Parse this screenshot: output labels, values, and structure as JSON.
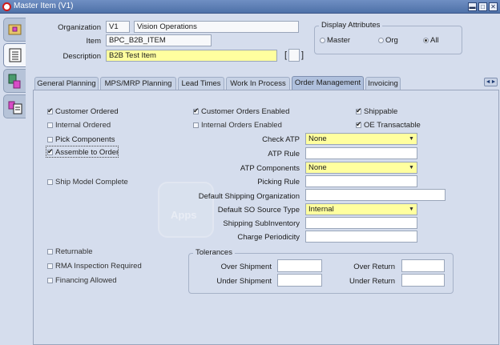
{
  "window": {
    "title": "Master Item (V1)",
    "min_label": "▬",
    "max_label": "□",
    "close_label": "✕"
  },
  "header": {
    "organization_label": "Organization",
    "organization_code": "V1",
    "organization_name": "Vision Operations",
    "item_label": "Item",
    "item_value": "BPC_B2B_ITEM",
    "description_label": "Description",
    "description_value": "B2B Test Item",
    "flex_open": "[",
    "flex_close": "]"
  },
  "display_attributes": {
    "legend": "Display Attributes",
    "options": [
      "Master",
      "Org",
      "All"
    ],
    "selected": "All"
  },
  "tabs": [
    "General Planning",
    "MPS/MRP Planning",
    "Lead Times",
    "Work In Process",
    "Order Management",
    "Invoicing"
  ],
  "active_tab": "Order Management",
  "order_management": {
    "customer_ordered": "Customer Ordered",
    "internal_ordered": "Internal Ordered",
    "pick_components": "Pick Components",
    "assemble_to_order": "Assemble to Order",
    "ship_model_complete": "Ship Model Complete",
    "customer_orders_enabled": "Customer Orders Enabled",
    "internal_orders_enabled": "Internal Orders Enabled",
    "shippable": "Shippable",
    "oe_transactable": "OE Transactable",
    "check_atp_label": "Check ATP",
    "check_atp_value": "None",
    "atp_rule_label": "ATP Rule",
    "atp_rule_value": "",
    "atp_components_label": "ATP Components",
    "atp_components_value": "None",
    "picking_rule_label": "Picking Rule",
    "picking_rule_value": "",
    "default_shipping_org_label": "Default Shipping Organization",
    "default_shipping_org_value": "",
    "default_so_source_type_label": "Default SO Source Type",
    "default_so_source_type_value": "Internal",
    "shipping_subinventory_label": "Shipping SubInventory",
    "shipping_subinventory_value": "",
    "charge_periodicity_label": "Charge Periodicity",
    "charge_periodicity_value": "",
    "returnable": "Returnable",
    "rma_inspection_required": "RMA Inspection Required",
    "financing_allowed": "Financing Allowed"
  },
  "tolerances": {
    "legend": "Tolerances",
    "over_shipment_label": "Over Shipment",
    "over_shipment_value": "",
    "under_shipment_label": "Under Shipment",
    "under_shipment_value": "",
    "over_return_label": "Over Return",
    "over_return_value": "",
    "under_return_label": "Under Return",
    "under_return_value": ""
  },
  "watermark": "Apps",
  "colors": {
    "required_field": "#ffff9f",
    "titlebar": "#5a7bb3",
    "background": "#d5dded",
    "active_tab": "#afc0dd"
  }
}
